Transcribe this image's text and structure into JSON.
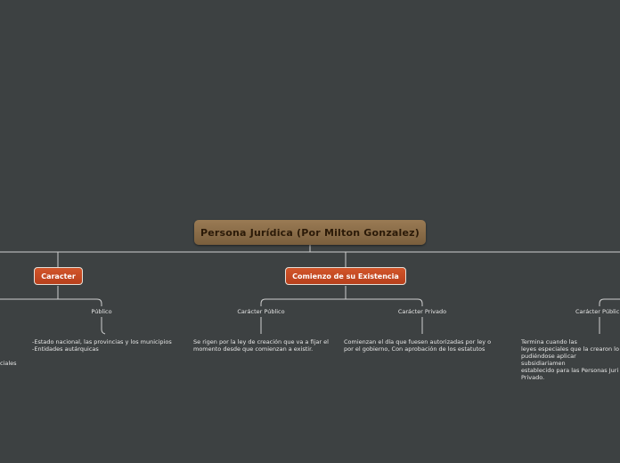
{
  "root": {
    "title": "Persona Jurídica (Por Milton Gonzalez)"
  },
  "branches": {
    "caracter": {
      "title": "Caracter",
      "sub_publico": "Público",
      "publico_text": "-Estado nacional, las provincias y los municipios\n-Entidades autárquicas",
      "left_fragment": "ciales"
    },
    "comienzo": {
      "title": "Comienzo de su Existencia",
      "sub_publico": "Carácter Público",
      "publico_text": "Se rigen por la ley de creación que va a fijar el\nmomento desde que comienzan a existir.",
      "sub_privado": "Carácter Privado",
      "privado_text": "Comienzan el día que fuesen autorizadas por ley o\npor el gobierno, Con aprobación de los estatutos"
    },
    "fin": {
      "sub_publico": "Carácter Públic",
      "publico_text": "Termina cuando las\nleyes especiales que la crearon lo\npudiéndose aplicar subsidiariamen\nestablecido para las Personas Juri\nPrivado."
    }
  },
  "colors": {
    "background": "#3d4142",
    "root_fill": "#8c6f4b",
    "main_fill": "#c94a22",
    "connector": "#d0d0d0"
  }
}
